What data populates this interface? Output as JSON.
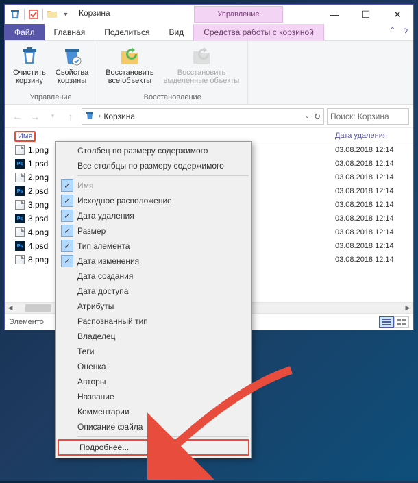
{
  "titlebar": {
    "title": "Корзина",
    "contextual_tab": "Управление"
  },
  "tabs": {
    "file": "Файл",
    "main": "Главная",
    "share": "Поделиться",
    "view": "Вид",
    "tools": "Средства работы с корзиной"
  },
  "ribbon": {
    "clear_bin": "Очистить\nкорзину",
    "bin_props": "Свойства\nкорзины",
    "restore_all": "Восстановить\nвсе объекты",
    "restore_sel": "Восстановить\nвыделенные объекты",
    "group_manage": "Управление",
    "group_restore": "Восстановление"
  },
  "nav": {
    "location": "Корзина",
    "search_placeholder": "Поиск: Корзина"
  },
  "columns": {
    "name": "Имя",
    "deleted": "Дата удаления"
  },
  "files": [
    {
      "name": "1.png",
      "type": "png",
      "deleted": "03.08.2018 12:14"
    },
    {
      "name": "1.psd",
      "type": "psd",
      "deleted": "03.08.2018 12:14"
    },
    {
      "name": "2.png",
      "type": "png",
      "deleted": "03.08.2018 12:14"
    },
    {
      "name": "2.psd",
      "type": "psd",
      "deleted": "03.08.2018 12:14"
    },
    {
      "name": "3.png",
      "type": "png",
      "deleted": "03.08.2018 12:14"
    },
    {
      "name": "3.psd",
      "type": "psd",
      "deleted": "03.08.2018 12:14"
    },
    {
      "name": "4.png",
      "type": "png",
      "deleted": "03.08.2018 12:14"
    },
    {
      "name": "4.psd",
      "type": "psd",
      "deleted": "03.08.2018 12:14"
    },
    {
      "name": "8.png",
      "type": "png",
      "deleted": "03.08.2018 12:14"
    }
  ],
  "status": {
    "left": "Элементо"
  },
  "context_menu": {
    "size_column": "Столбец по размеру содержимого",
    "all_columns": "Все столбцы по размеру содержимого",
    "items": [
      {
        "label": "Имя",
        "checked": true,
        "disabled": true
      },
      {
        "label": "Исходное расположение",
        "checked": true
      },
      {
        "label": "Дата удаления",
        "checked": true
      },
      {
        "label": "Размер",
        "checked": true
      },
      {
        "label": "Тип элемента",
        "checked": true
      },
      {
        "label": "Дата изменения",
        "checked": true
      },
      {
        "label": "Дата создания",
        "checked": false
      },
      {
        "label": "Дата доступа",
        "checked": false
      },
      {
        "label": "Атрибуты",
        "checked": false
      },
      {
        "label": "Распознанный тип",
        "checked": false
      },
      {
        "label": "Владелец",
        "checked": false
      },
      {
        "label": "Теги",
        "checked": false
      },
      {
        "label": "Оценка",
        "checked": false
      },
      {
        "label": "Авторы",
        "checked": false
      },
      {
        "label": "Название",
        "checked": false
      },
      {
        "label": "Комментарии",
        "checked": false
      },
      {
        "label": "Описание файла",
        "checked": false
      }
    ],
    "more": "Подробнее..."
  }
}
